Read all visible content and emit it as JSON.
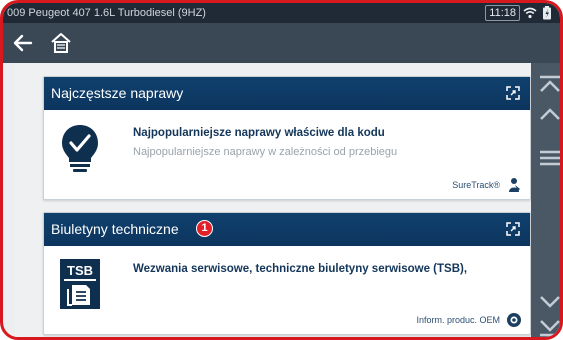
{
  "statusbar": {
    "title": "009 Peugeot 407 1.6L Turbodiesel (9HZ)",
    "time": "11:18"
  },
  "icons": {
    "back": "back-arrow-icon",
    "home": "home-icon",
    "wifi": "wifi-icon",
    "battery": "battery-icon",
    "expand": "expand-icon",
    "lightbulb": "lightbulb-check-icon",
    "tsb": "tsb-document-icon",
    "suretrack": "suretrack-icon",
    "oem": "oem-info-icon",
    "rail": [
      "double-chevron-up-icon",
      "chevron-up-icon",
      "menu-icon",
      "chevron-down-icon",
      "double-chevron-down-icon"
    ]
  },
  "cards": {
    "repairs": {
      "header": "Najczęstsze naprawy",
      "title": "Najpopularniejsze naprawy właściwe dla kodu",
      "subtitle": "Najpopularniejsze naprawy w zależności od przebiegu",
      "footer": "SureTrack®"
    },
    "bulletins": {
      "header": "Biuletyny techniczne",
      "badge": "1",
      "icon_label": "TSB",
      "title": "Wezwania serwisowe, techniczne biuletyny serwisowe (TSB),",
      "footer": "Inform. produc. OEM"
    }
  },
  "colors": {
    "header_blue": "#0c355e",
    "badge_red": "#e1202a",
    "frame_red": "#d7191f",
    "toolbar": "#3a4856"
  }
}
